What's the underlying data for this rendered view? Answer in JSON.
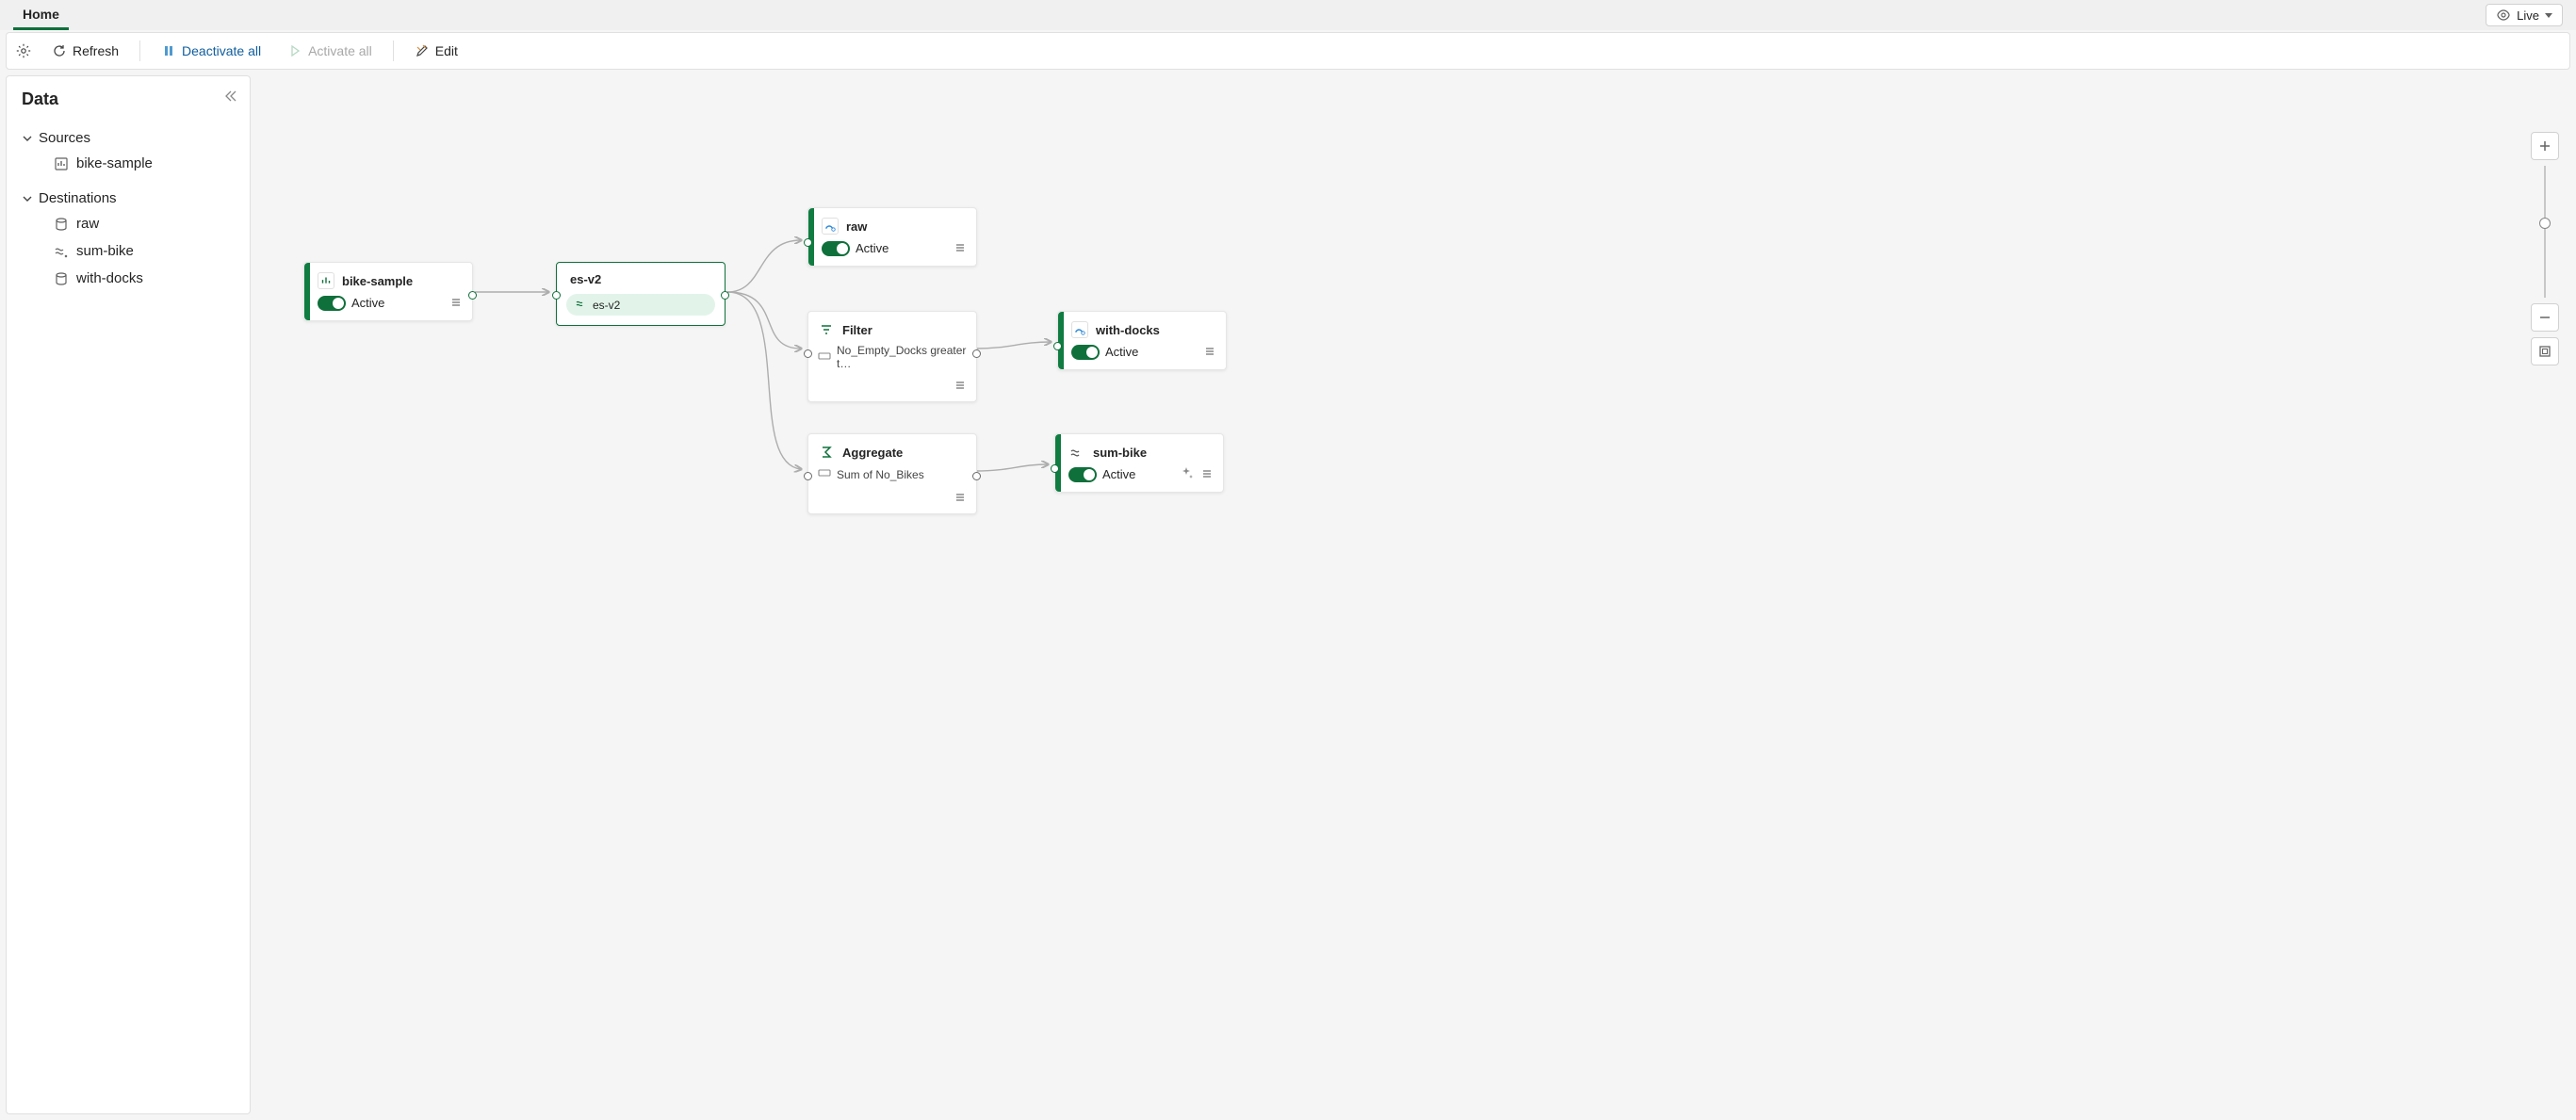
{
  "tabs": {
    "home": "Home"
  },
  "live": {
    "label": "Live"
  },
  "toolbar": {
    "refresh": "Refresh",
    "deactivate_all": "Deactivate all",
    "activate_all": "Activate all",
    "edit": "Edit"
  },
  "sidebar": {
    "title": "Data",
    "sources_label": "Sources",
    "destinations_label": "Destinations",
    "sources": [
      {
        "label": "bike-sample"
      }
    ],
    "destinations": [
      {
        "label": "raw"
      },
      {
        "label": "sum-bike"
      },
      {
        "label": "with-docks"
      }
    ]
  },
  "nodes": {
    "bike_sample": {
      "title": "bike-sample",
      "status": "Active"
    },
    "es_v2": {
      "title": "es-v2",
      "chip": "es-v2"
    },
    "raw": {
      "title": "raw",
      "status": "Active"
    },
    "filter": {
      "title": "Filter",
      "rule": "No_Empty_Docks greater t…"
    },
    "aggregate": {
      "title": "Aggregate",
      "rule": "Sum of No_Bikes"
    },
    "with_docks": {
      "title": "with-docks",
      "status": "Active"
    },
    "sum_bike": {
      "title": "sum-bike",
      "status": "Active"
    }
  }
}
